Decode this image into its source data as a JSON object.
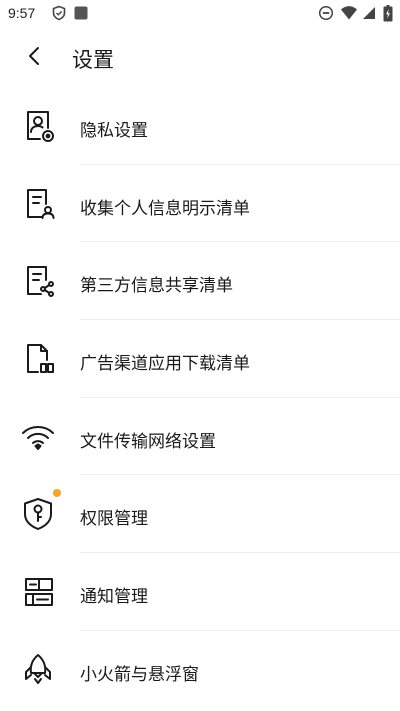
{
  "status_bar": {
    "time": "9:57"
  },
  "header": {
    "title": "设置"
  },
  "menu": [
    {
      "label": "隐私设置",
      "icon": "privacy-settings-icon"
    },
    {
      "label": "收集个人信息明示清单",
      "icon": "personal-info-list-icon"
    },
    {
      "label": "第三方信息共享清单",
      "icon": "third-party-share-icon"
    },
    {
      "label": "广告渠道应用下载清单",
      "icon": "ad-download-list-icon"
    },
    {
      "label": "文件传输网络设置",
      "icon": "wifi-icon"
    },
    {
      "label": "权限管理",
      "icon": "permission-key-icon",
      "badge": true
    },
    {
      "label": "通知管理",
      "icon": "notification-manage-icon"
    },
    {
      "label": "小火箭与悬浮窗",
      "icon": "rocket-icon"
    }
  ],
  "colors": {
    "badge": "#f5a623",
    "text": "#1a1a1a",
    "icon_stroke": "#1a1a1a"
  }
}
